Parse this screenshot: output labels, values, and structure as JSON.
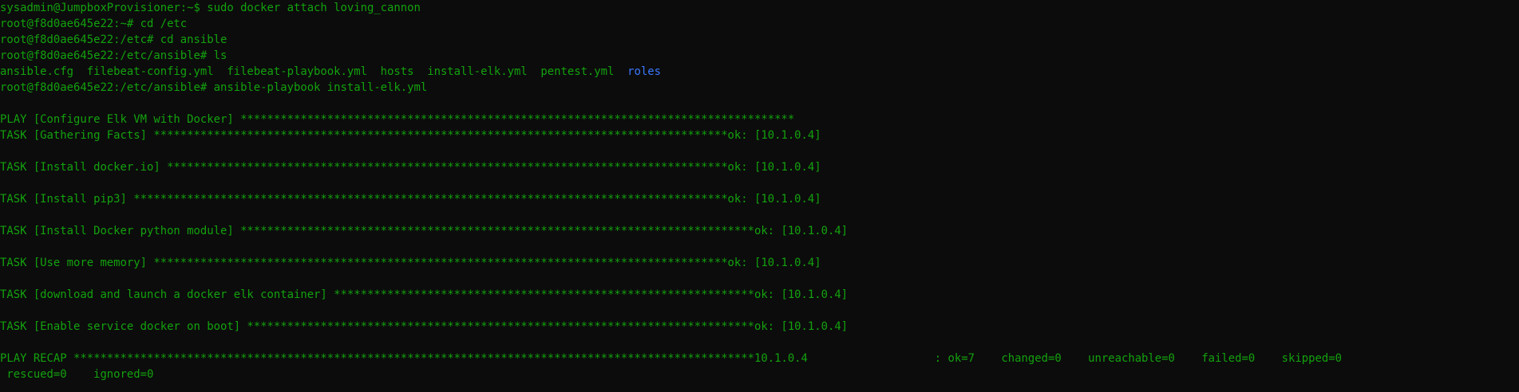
{
  "colors": {
    "background": "#0c0c0c",
    "text_green": "#13a10e",
    "directory_blue": "#3b78ff"
  },
  "lines": {
    "l0": "sysadmin@JumpboxProvisioner:~$ sudo docker attach loving_cannon",
    "l1": "root@f8d0ae645e22:~# cd /etc",
    "l2": "root@f8d0ae645e22:/etc# cd ansible",
    "l3": "root@f8d0ae645e22:/etc/ansible# ls",
    "l4_files": "ansible.cfg  filebeat-config.yml  filebeat-playbook.yml  hosts  install-elk.yml  pentest.yml  ",
    "l4_dir": "roles",
    "l5": "root@f8d0ae645e22:/etc/ansible# ansible-playbook install-elk.yml",
    "play": "PLAY [Configure Elk VM with Docker] ***********************************************************************************",
    "task_gather": "TASK [Gathering Facts] **************************************************************************************ok: [10.1.0.4]",
    "task_docker_io": "TASK [Install docker.io] ************************************************************************************ok: [10.1.0.4]",
    "task_pip3": "TASK [Install pip3] *****************************************************************************************ok: [10.1.0.4]",
    "task_python_module": "TASK [Install Docker python module] *****************************************************************************ok: [10.1.0.4]",
    "task_memory": "TASK [Use more memory] **************************************************************************************ok: [10.1.0.4]",
    "task_elk_container": "TASK [download and launch a docker elk container] ***************************************************************ok: [10.1.0.4]",
    "task_docker_boot": "TASK [Enable service docker on boot] ****************************************************************************ok: [10.1.0.4]",
    "recap": "PLAY RECAP ******************************************************************************************************10.1.0.4                   : ok=7    changed=0    unreachable=0    failed=0    skipped=0",
    "recap_cont": " rescued=0    ignored=0"
  }
}
